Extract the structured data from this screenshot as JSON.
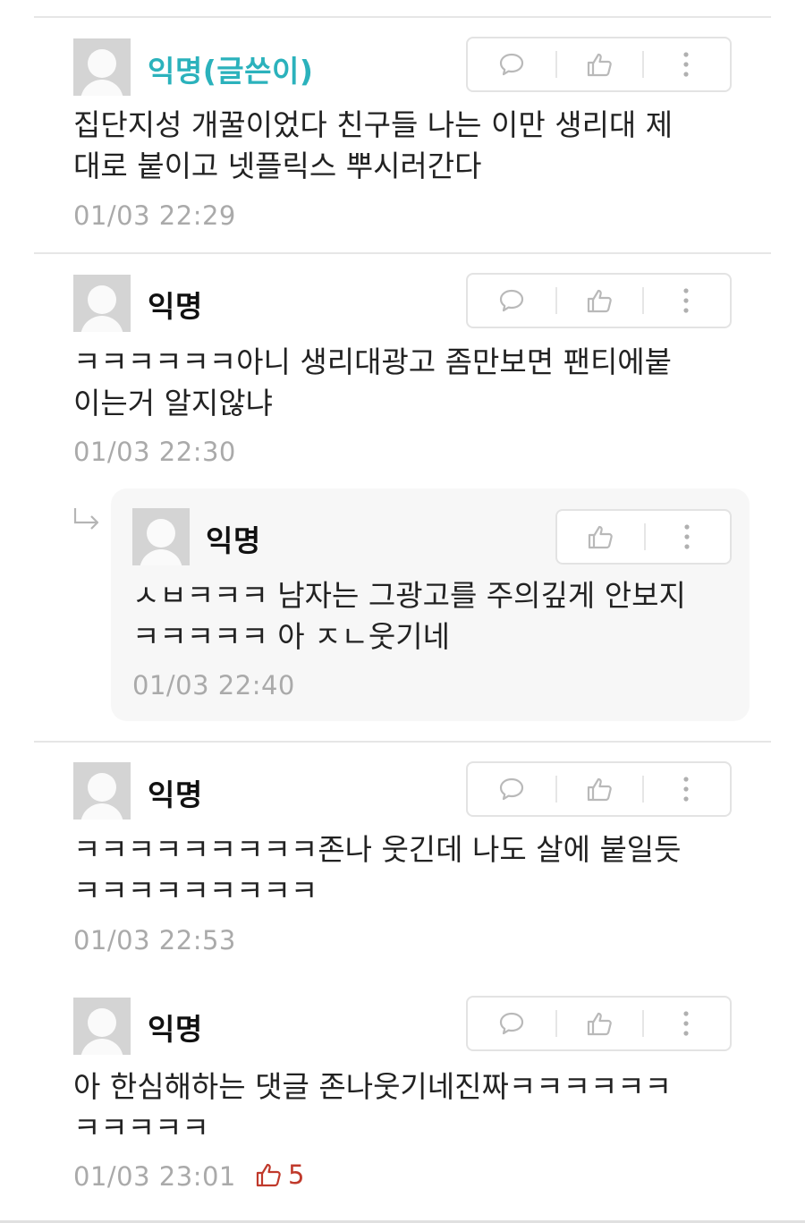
{
  "comments": [
    {
      "author": "익명(글쓴이)",
      "lines": [
        "집단지성 개꿀이었다 친구들 나는 이만 생리대 제",
        "대로 붙이고 넷플릭스 뿌시러간다"
      ],
      "time": "01/03 22:29",
      "actions": [
        "comment-icon",
        "thumbs-up-icon",
        "more-icon"
      ]
    },
    {
      "author": "익명",
      "lines": [
        "ㅋㅋㅋㅋㅋㅋ아니 생리대광고 좀만보면 팬티에붙",
        "이는거 알지않냐"
      ],
      "time": "01/03 22:30",
      "actions": [
        "comment-icon",
        "thumbs-up-icon",
        "more-icon"
      ]
    },
    {
      "author": "익명",
      "lines": [
        "ㅅㅂㅋㅋㅋ 남자는 그광고를 주의깊게 안보지",
        "ㅋㅋㅋㅋㅋ 아 ㅈㄴ웃기네"
      ],
      "time": "01/03 22:40",
      "is_reply": true,
      "actions": [
        "thumbs-up-icon",
        "more-icon"
      ]
    },
    {
      "author": "익명",
      "lines": [
        "ㅋㅋㅋㅋㅋㅋㅋㅋㅋ존나 웃긴데 나도 살에 붙일듯",
        "ㅋㅋㅋㅋㅋㅋㅋㅋㅋ"
      ],
      "time": "01/03 22:53",
      "actions": [
        "comment-icon",
        "thumbs-up-icon",
        "more-icon"
      ]
    },
    {
      "author": "익명",
      "lines": [
        "아 한심해하는 댓글 존나웃기네진짜ㅋㅋㅋㅋㅋㅋ",
        "ㅋㅋㅋㅋㅋ"
      ],
      "time": "01/03 23:01",
      "likes": "5",
      "actions": [
        "comment-icon",
        "thumbs-up-icon",
        "more-icon"
      ]
    }
  ],
  "colors": {
    "op_author": "#2bb2bc",
    "like_count": "#c0392b",
    "timestamp": "#aaaaaa"
  }
}
